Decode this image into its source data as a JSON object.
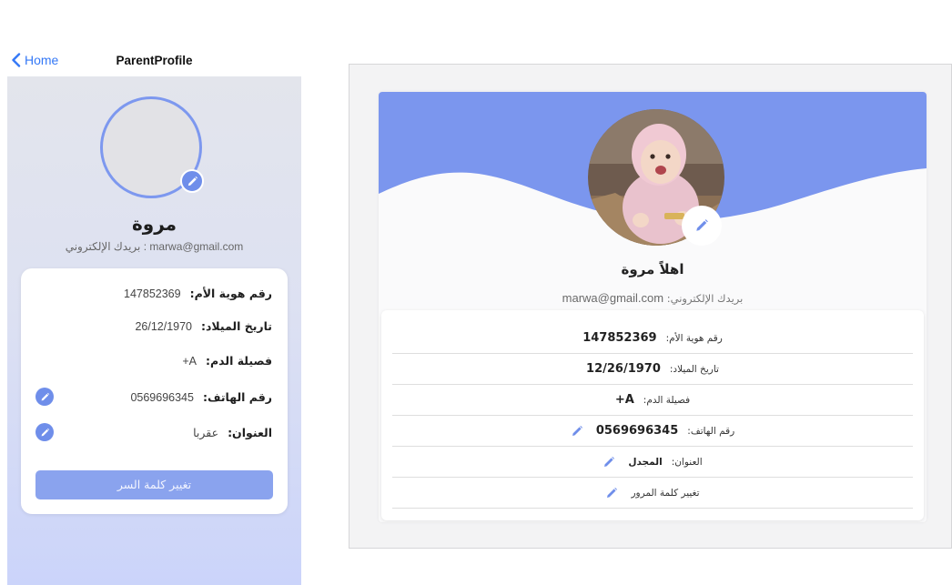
{
  "mobile": {
    "nav": {
      "back_label": "Home",
      "title": "ParentProfile"
    },
    "profile": {
      "name": "مروة",
      "email_line": "بريدك الإلكتروني : marwa@gmail.com"
    },
    "fields": [
      {
        "label": "رقم هوية الأم:",
        "value": "147852369"
      },
      {
        "label": "تاريخ الميلاد:",
        "value": "26/12/1970"
      },
      {
        "label": "فصيلة الدم:",
        "value": "A+"
      },
      {
        "label": "رقم الهاتف:",
        "value": "0569696345"
      },
      {
        "label": "العنوان:",
        "value": "عقربا"
      }
    ],
    "change_password_label": "تغيير كلمة السر"
  },
  "web": {
    "greeting": "اهلاً مروة",
    "email_label": "بريدك الإلكتروني:",
    "email_value": "marwa@gmail.com",
    "fields": [
      {
        "label": "رقم هوية الأم:",
        "value": "147852369"
      },
      {
        "label": "تاريخ الميلاد:",
        "value": "12/26/1970"
      },
      {
        "label": "فصيلة الدم:",
        "value": "A+"
      },
      {
        "label": "رقم الهاتف:",
        "value": "0569696345"
      },
      {
        "label": "العنوان:",
        "value": "المجدل"
      }
    ],
    "change_password_label": "تغيير كلمة المرور"
  },
  "colors": {
    "accent": "#6f8eea",
    "header_wave": "#7b96ee",
    "link_blue": "#3478f6",
    "button": "#8aa3ee"
  },
  "icons": [
    "chevron-left-icon",
    "pencil-icon",
    "child-photo"
  ]
}
